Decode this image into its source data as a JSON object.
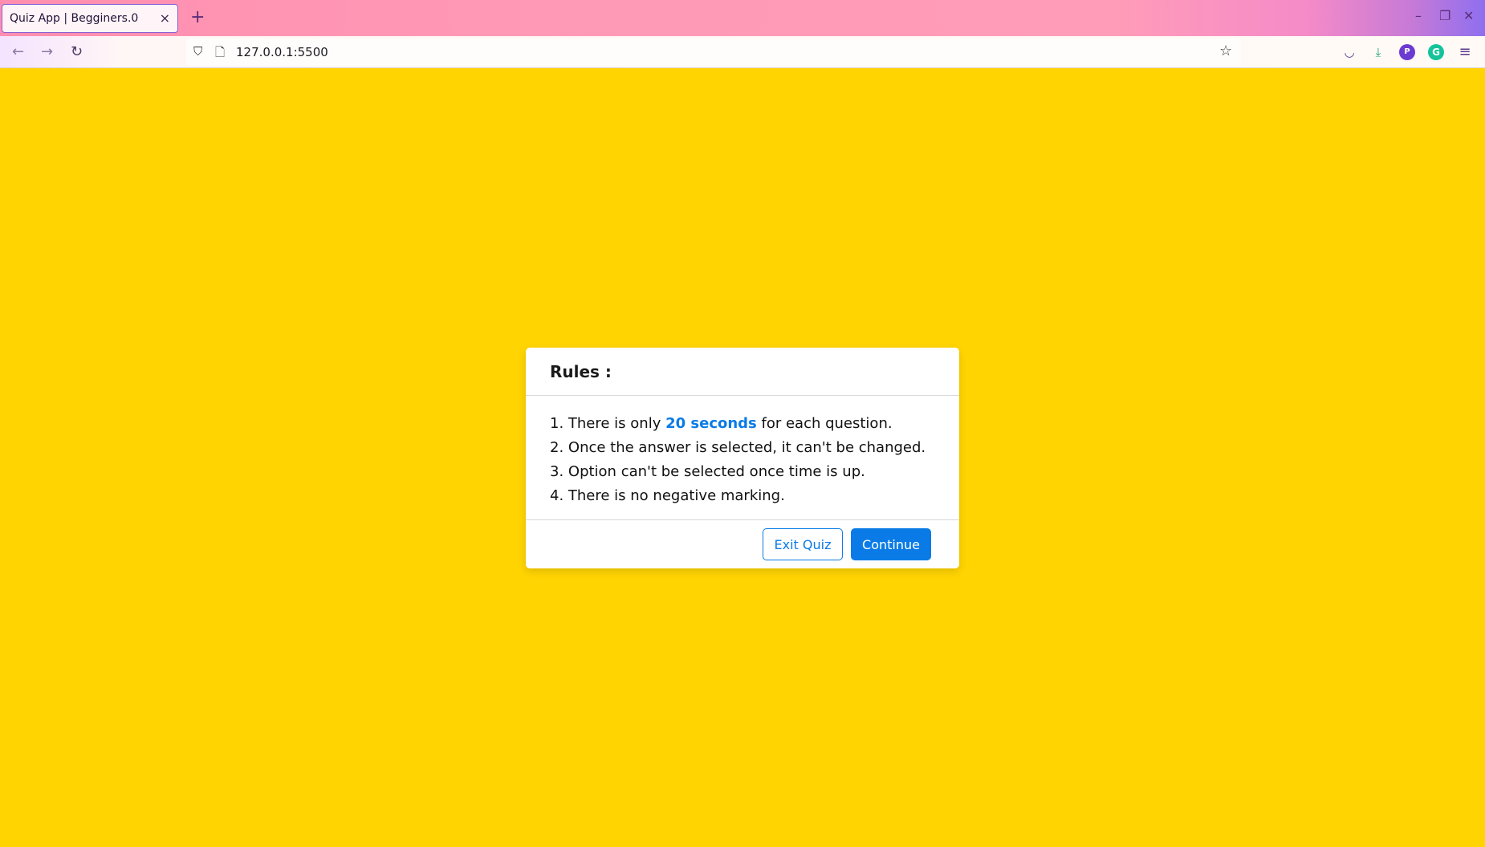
{
  "browser": {
    "tab_title": "Quiz App | Begginers.0",
    "tab_close": "×",
    "new_tab": "+",
    "url": "127.0.0.1:5500",
    "profile_initial": "P",
    "extension_initial": "G"
  },
  "icons": {
    "back": "←",
    "forward": "→",
    "reload": "↻",
    "shield": "⛉",
    "page": "🗋",
    "star": "☆",
    "pocket": "◡",
    "download": "⤓",
    "menu": "≡",
    "minimize": "–",
    "restore": "❐",
    "close": "✕"
  },
  "dialog": {
    "title": "Rules :",
    "rules": [
      {
        "prefix": "1. There is only ",
        "highlight": "20 seconds",
        "suffix": " for each question."
      },
      {
        "text": "2. Once the answer is selected, it can't be changed."
      },
      {
        "text": "3. Option can't be selected once time is up."
      },
      {
        "text": "4. There is no negative marking."
      }
    ],
    "exit_label": "Exit Quiz",
    "continue_label": "Continue"
  },
  "colors": {
    "page_background": "#ffd400",
    "accent": "#0a7be6"
  }
}
